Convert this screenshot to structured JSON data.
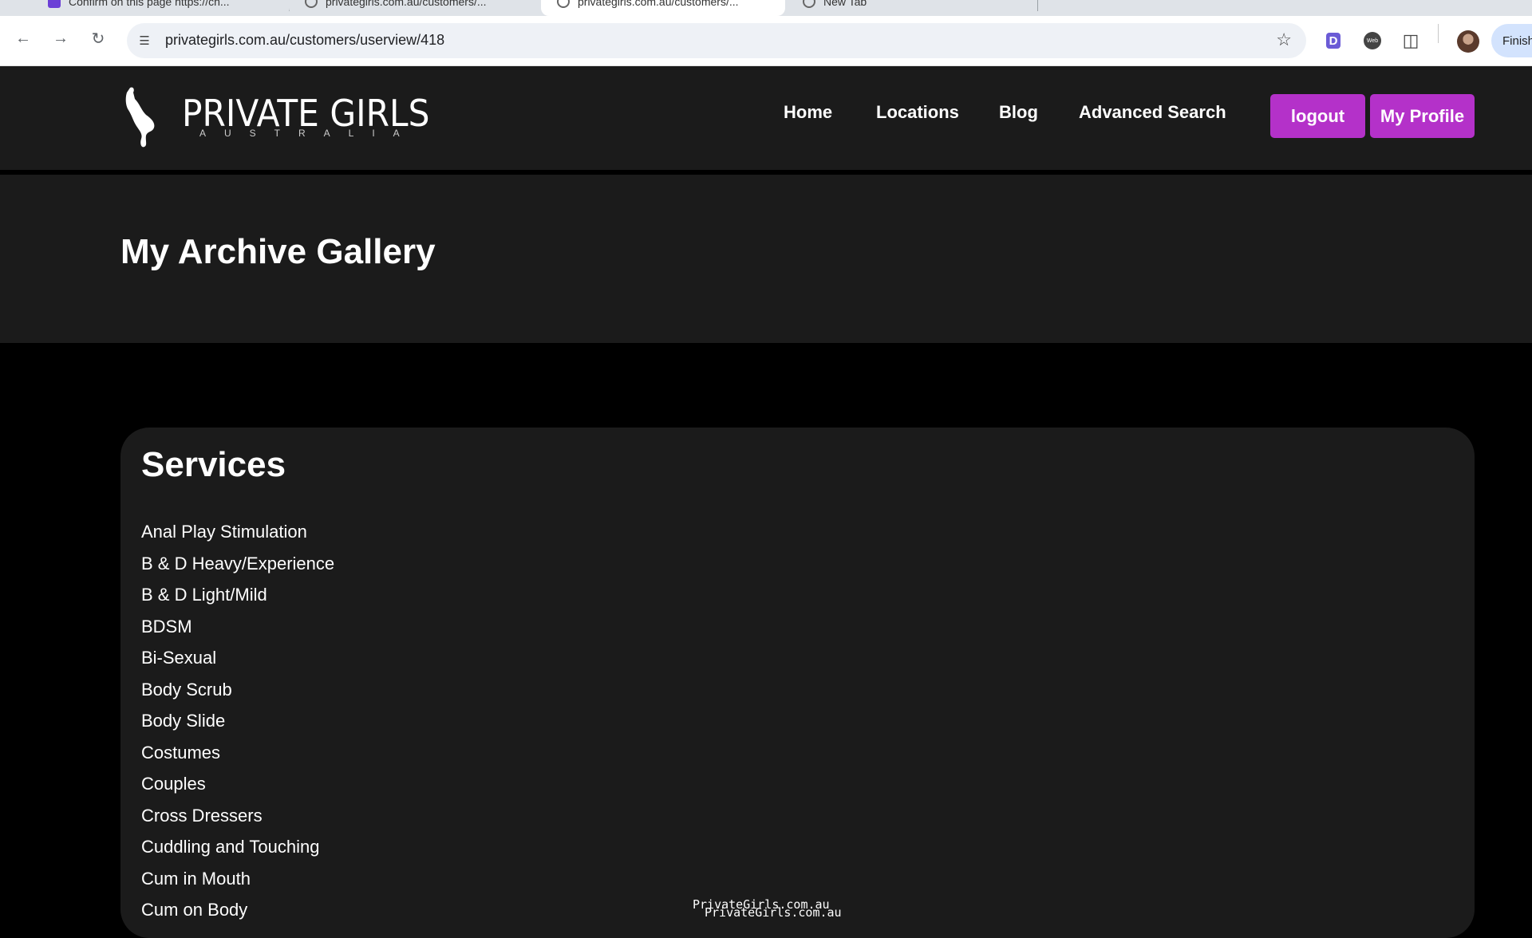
{
  "browser": {
    "tabs": [
      {
        "label": "Confirm on this page https://ch..."
      },
      {
        "label": "privategirls.com.au/customers/..."
      },
      {
        "label": "privategirls.com.au/customers/..."
      },
      {
        "label": "New Tab"
      }
    ],
    "url": "privategirls.com.au/customers/userview/418",
    "finish_label": "Finish"
  },
  "site": {
    "logo_text": "PRIVATE GIRLS",
    "logo_sub": "AUSTRALIA",
    "nav": [
      "Home",
      "Locations",
      "Blog",
      "Advanced Search"
    ],
    "logout_label": "logout",
    "profile_label": "My Profile"
  },
  "page": {
    "title": "My Archive Gallery"
  },
  "services": {
    "title": "Services",
    "items": [
      "Anal Play Stimulation",
      "B & D Heavy/Experience",
      "B & D Light/Mild",
      "BDSM",
      "Bi-Sexual",
      "Body Scrub",
      "Body Slide",
      "Costumes",
      "Couples",
      "Cross Dressers",
      "Cuddling and Touching",
      "Cum in Mouth",
      "Cum on Body"
    ]
  },
  "watermark": [
    "PrivateGirls.com.au",
    "PrivateGirls.com.au"
  ],
  "colors": {
    "accent": "#b431c9",
    "header_bg": "#1b1b1b"
  }
}
